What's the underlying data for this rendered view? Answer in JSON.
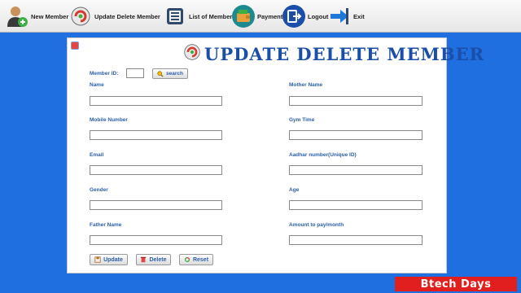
{
  "toolbar": {
    "new_member": "New Member",
    "update_delete": "Update Delete Member",
    "list_members": "List of Members",
    "payment": "Payment",
    "logout": "Logout",
    "exit": "Exit"
  },
  "form": {
    "title": "UPDATE DELETE MEMBER",
    "member_id_label": "Member ID:",
    "member_id_value": "",
    "search_label": "search",
    "left_fields": [
      {
        "label": "Name",
        "value": ""
      },
      {
        "label": "Mobile Number",
        "value": ""
      },
      {
        "label": "Email",
        "value": ""
      },
      {
        "label": "Gender",
        "value": ""
      },
      {
        "label": "Father Name",
        "value": ""
      }
    ],
    "right_fields": [
      {
        "label": "Mother Name",
        "value": ""
      },
      {
        "label": "Gym Time",
        "value": ""
      },
      {
        "label": "Aadhar number(Unique ID)",
        "value": ""
      },
      {
        "label": "Age",
        "value": ""
      },
      {
        "label": "Amount to pay/month",
        "value": ""
      }
    ],
    "update_label": "Update",
    "delete_label": "Delete",
    "reset_label": "Reset"
  },
  "brand": "Btech Days",
  "colors": {
    "background": "#1f6fe0",
    "title": "#1a4ea8",
    "label": "#2b5fa8",
    "brand": "#e11f1f"
  }
}
